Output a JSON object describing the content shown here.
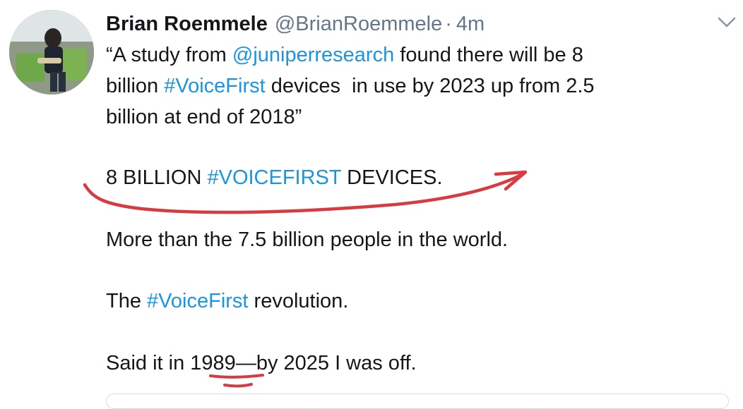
{
  "tweet": {
    "display_name": "Brian Roemmele",
    "handle": "@BrianRoemmele",
    "separator": "·",
    "timestamp": "4m",
    "avatar_icon": "user-avatar-photo",
    "menu_icon": "chevron-down-icon",
    "paragraphs": {
      "p1": {
        "segments": [
          {
            "text": "“A study from ",
            "link": false
          },
          {
            "text": "@juniperresearch",
            "link": true
          },
          {
            "text": " found there will be 8",
            "link": false
          }
        ],
        "line2": [
          {
            "text": "billion ",
            "link": false
          },
          {
            "text": "#VoiceFirst",
            "link": true
          },
          {
            "text": " devices  in use by 2023 up from 2.5",
            "link": false
          }
        ],
        "line3": "billion at end of 2018”"
      },
      "p2": {
        "before": "8 BILLION ",
        "hashtag": "#VOICEFIRST",
        "after": " DEVICES."
      },
      "p3": "More than the 7.5 billion people in the world.",
      "p4": {
        "before": "The ",
        "hashtag": "#VoiceFirst",
        "after": " revolution."
      },
      "p5": {
        "before": "Said it in ",
        "year": "1989",
        "after": "—by 2025 I was off."
      }
    }
  },
  "colors": {
    "text": "#14171a",
    "muted": "#657786",
    "link": "#1b95e0",
    "annotation": "#d93a3f"
  }
}
